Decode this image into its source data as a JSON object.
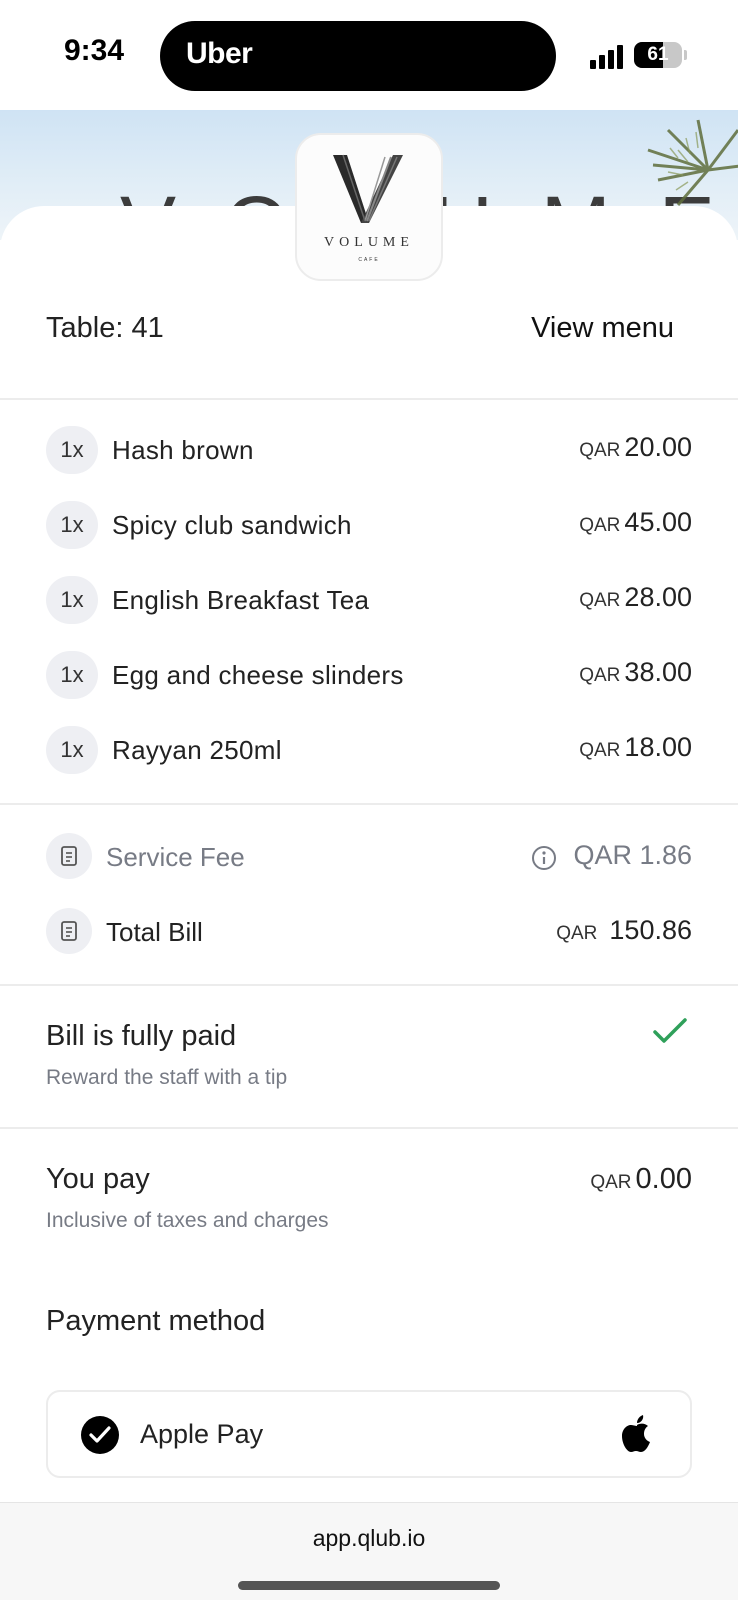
{
  "status_bar": {
    "time": "9:34",
    "island_app": "Uber",
    "battery": "61",
    "battery_level": 0.61
  },
  "banner": {
    "text": "VOLUME"
  },
  "restaurant": {
    "logo_name": "VOLUME",
    "logo_sub": "CAFE"
  },
  "header": {
    "table": "Table: 41",
    "view_menu": "View menu"
  },
  "items": [
    {
      "qty": "1x",
      "name": "Hash brown",
      "currency": "QAR",
      "price": "20.00"
    },
    {
      "qty": "1x",
      "name": "Spicy club sandwich",
      "currency": "QAR",
      "price": "45.00"
    },
    {
      "qty": "1x",
      "name": "English Breakfast Tea",
      "currency": "QAR",
      "price": "28.00"
    },
    {
      "qty": "1x",
      "name": "Egg and cheese slinders",
      "currency": "QAR",
      "price": "38.00"
    },
    {
      "qty": "1x",
      "name": "Rayyan 250ml",
      "currency": "QAR",
      "price": "18.00"
    }
  ],
  "fees": {
    "service_fee_label": "Service Fee",
    "service_fee_value": "QAR 1.86",
    "total_label": "Total Bill",
    "total_currency": "QAR",
    "total_value": "150.86"
  },
  "bill_status": {
    "title": "Bill is fully paid",
    "subtitle": "Reward the staff with a tip"
  },
  "you_pay": {
    "title": "You pay",
    "subtitle": "Inclusive of taxes and charges",
    "currency": "QAR",
    "amount": "0.00"
  },
  "payment": {
    "title": "Payment method",
    "method": "Apple Pay"
  },
  "browser": {
    "url": "app.qlub.io"
  },
  "colors": {
    "check_green": "#2fa05a",
    "muted_text": "#777b85",
    "chip_bg": "#eeeff3"
  }
}
